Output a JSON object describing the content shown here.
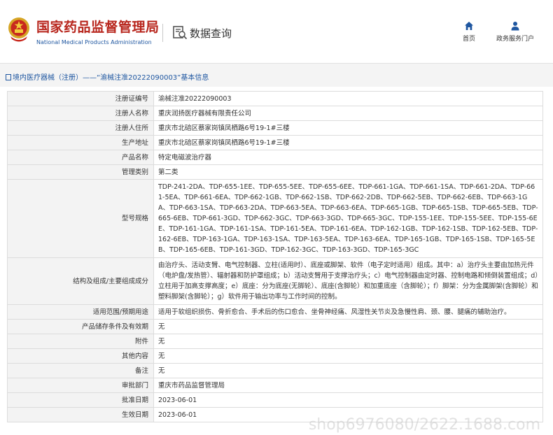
{
  "header": {
    "logo_cn": "国家药品监督管理局",
    "logo_en": "National Medical Products Administration",
    "query_title": "数据查询",
    "nav": [
      {
        "label": "首页",
        "icon": "home-icon"
      },
      {
        "label": "政务服务门户",
        "icon": "user-icon"
      }
    ]
  },
  "breadcrumb": "境内医疗器械（注册）——“渝械注准20222090003”基本信息",
  "rows": [
    {
      "label": "注册证编号",
      "value": "渝械注准20222090003"
    },
    {
      "label": "注册人名称",
      "value": "重庆润扬医疗器械有限责任公司"
    },
    {
      "label": "注册人住所",
      "value": "重庆市北碚区蔡家岗镇凤栖路6号19-1#三楼"
    },
    {
      "label": "生产地址",
      "value": "重庆市北碚区蔡家岗镇凤栖路6号19-1#三楼"
    },
    {
      "label": "产品名称",
      "value": "特定电磁波治疗器"
    },
    {
      "label": "管理类别",
      "value": "第二类"
    },
    {
      "label": "型号规格",
      "value": "TDP-241-2DA、TDP-655-1EE、TDP-655-5EE、TDP-655-6EE、TDP-661-1GA、TDP-661-1SA、TDP-661-2DA、TDP-661-5EA、TDP-661-6EA、TDP-662-1GB、TDP-662-1SB、TDP-662-2DB、TDP-662-5EB、TDP-662-6EB、TDP-663-1GA、TDP-663-1SA、TDP-663-2DA、TDP-663-5EA、TDP-663-6EA、TDP-665-1GB、TDP-665-1SB、TDP-665-5EB、TDP-665-6EB、TDP-661-3GD、TDP-662-3GC、TDP-663-3GD、TDP-665-3GC、TDP-155-1EE、TDP-155-5EE、TDP-155-6EE、TDP-161-1GA、TDP-161-1SA、TDP-161-5EA、TDP-161-6EA、TDP-162-1GB、TDP-162-1SB、TDP-162-5EB、TDP-162-6EB、TDP-163-1GA、TDP-163-1SA、TDP-163-5EA、TDP-163-6EA、TDP-165-1GB、TDP-165-1SB、TDP-165-5EB、TDP-165-6EB、TDP-161-3GD、TDP-162-3GC、TDP-163-3GD、TDP-165-3GC"
    },
    {
      "label": "结构及组成/主要组成成分",
      "value": "由治疗头、活动支臂、电气控制器、立柱(适用时）、底座或脚架、软件（电子定时适用）组成。其中：a）治疗头主要由加热元件（电炉盘/发热管）、辐射器和防护罩组成；b）活动支臂用于支撑治疗头；c）电气控制器由定时器、控制电路和倾倒装置组成；d）立柱用于加高支撑高度；e）底座：分为底座(无脚轮）、底座(含脚轮）和加重底座（含脚轮）；f）脚架：分为金属脚架(含脚轮）和塑料脚架(含脚轮）；g）软件用于输出功率与工作时间的控制。"
    },
    {
      "label": "适用范围/预期用途",
      "value": "适用于软组织损伤、骨折愈合、手术后的伤口愈合、坐骨神经痛、风湿性关节炎及急慢性肩、颈、腰、腿痛的辅助治疗。"
    },
    {
      "label": "产品储存条件及有效期",
      "value": "无"
    },
    {
      "label": "附件",
      "value": "无"
    },
    {
      "label": "其他内容",
      "value": "无"
    },
    {
      "label": "备注",
      "value": "无"
    },
    {
      "label": "审批部门",
      "value": "重庆市药品监督管理局"
    },
    {
      "label": "批准日期",
      "value": "2023-06-01"
    },
    {
      "label": "生效日期",
      "value": "2023-06-01"
    }
  ],
  "watermark": "shop6976080/2622.1688.com",
  "colors": {
    "brand_red": "#b8261d",
    "link_blue": "#1e56a0",
    "label_bg": "#f3f3f3",
    "border": "#dcdcdc"
  }
}
